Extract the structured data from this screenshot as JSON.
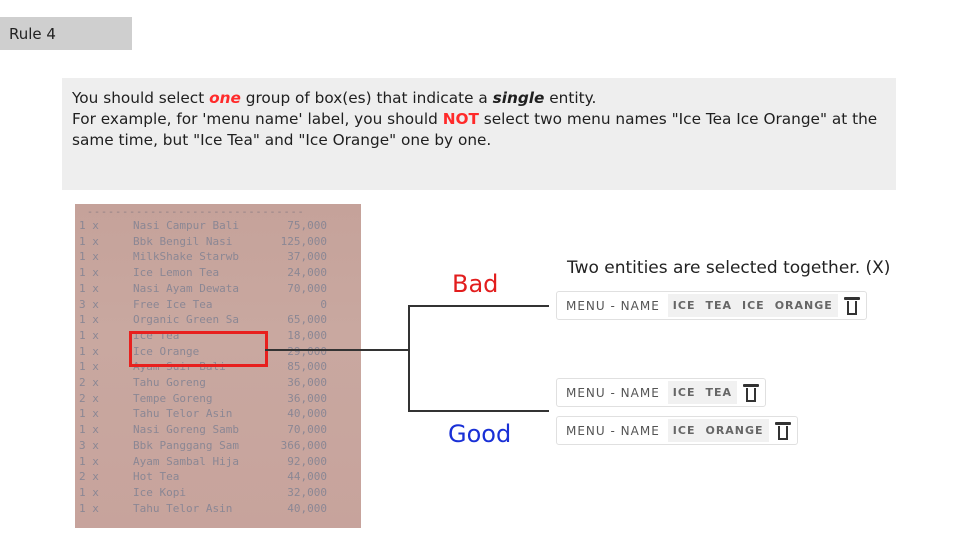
{
  "rule_tab": "Rule 4",
  "instruction": {
    "line1_a": "You should select ",
    "line1_one": "one",
    "line1_b": " group of box(es) that indicate a ",
    "line1_single": "single",
    "line1_c": " entity.",
    "line2_a": "For example, for 'menu name' label, you should ",
    "line2_not": "NOT",
    "line2_b": " select two menu names \"Ice Tea Ice Orange\" at the same time, but \"Ice Tea\" and \"Ice Orange\" one by one."
  },
  "receipt": {
    "dash": "-------------------------------",
    "rows": [
      {
        "q": "1 x",
        "n": "Nasi Campur Bali",
        "p": "75,000"
      },
      {
        "q": "1 x",
        "n": "Bbk Bengil Nasi",
        "p": "125,000"
      },
      {
        "q": "1 x",
        "n": "MilkShake Starwb",
        "p": "37,000"
      },
      {
        "q": "1 x",
        "n": "Ice Lemon Tea",
        "p": "24,000"
      },
      {
        "q": "1 x",
        "n": "Nasi Ayam Dewata",
        "p": "70,000"
      },
      {
        "q": "3 x",
        "n": "Free Ice Tea",
        "p": "0"
      },
      {
        "q": "1 x",
        "n": "Organic Green Sa",
        "p": "65,000"
      },
      {
        "q": "1 x",
        "n": "Ice Tea",
        "p": "18,000"
      },
      {
        "q": "1 x",
        "n": "Ice Orange",
        "p": "29,000"
      },
      {
        "q": "1 x",
        "n": "Ayam Suir Bali",
        "p": "85,000"
      },
      {
        "q": "2 x",
        "n": "Tahu Goreng",
        "p": "36,000"
      },
      {
        "q": "2 x",
        "n": "Tempe Goreng",
        "p": "36,000"
      },
      {
        "q": "1 x",
        "n": "Tahu Telor Asin",
        "p": "40,000"
      },
      {
        "q": "1 x",
        "n": "Nasi Goreng Samb",
        "p": "70,000"
      },
      {
        "q": "3 x",
        "n": "Bbk Panggang Sam",
        "p": "366,000"
      },
      {
        "q": "1 x",
        "n": "Ayam Sambal Hija",
        "p": "92,000"
      },
      {
        "q": "2 x",
        "n": "Hot Tea",
        "p": "44,000"
      },
      {
        "q": "1 x",
        "n": "Ice Kopi",
        "p": "32,000"
      },
      {
        "q": "1 x",
        "n": "Tahu Telor Asin",
        "p": "40,000"
      }
    ]
  },
  "bad_label": "Bad",
  "good_label": "Good",
  "caption": "Two entities are selected together. (X)",
  "annotations": {
    "bad": {
      "label": "MENU - NAME",
      "tokens": [
        "ICE",
        "TEA",
        "ICE",
        "ORANGE"
      ]
    },
    "good1": {
      "label": "MENU - NAME",
      "tokens": [
        "ICE",
        "TEA"
      ]
    },
    "good2": {
      "label": "MENU - NAME",
      "tokens": [
        "ICE",
        "ORANGE"
      ]
    }
  },
  "icons": {
    "delete": "trash-icon"
  },
  "colors": {
    "bad": "#e21d1d",
    "good": "#1930d6",
    "highlight": "#e8201e"
  }
}
